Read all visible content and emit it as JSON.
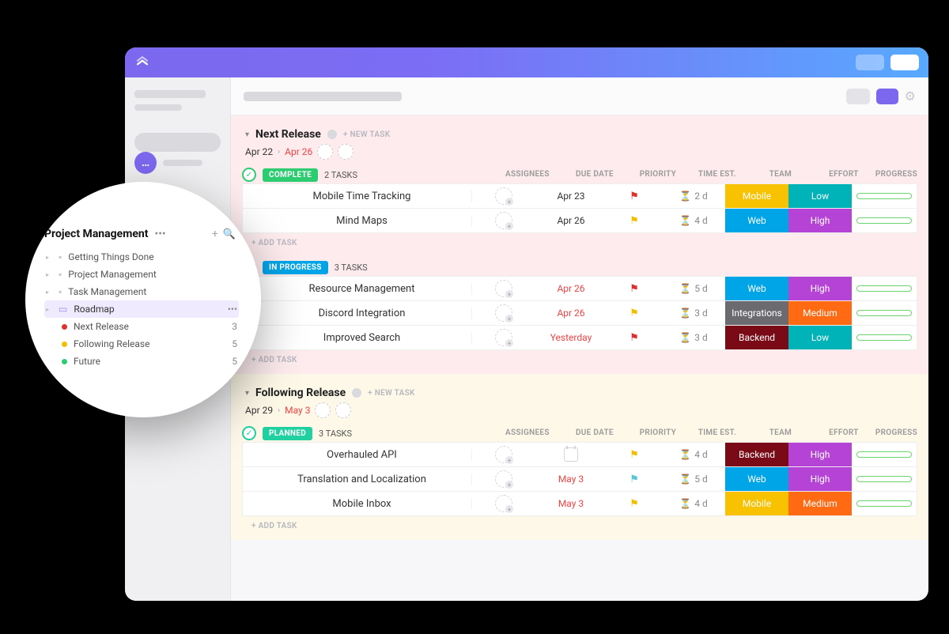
{
  "sidebar": {
    "title": "Project Management",
    "items": [
      {
        "label": "Getting Things Done"
      },
      {
        "label": "Project Management"
      },
      {
        "label": "Task Management"
      },
      {
        "label": "Roadmap",
        "selected": true
      }
    ],
    "sublists": [
      {
        "label": "Next Release",
        "count": "3",
        "dot": "red"
      },
      {
        "label": "Following Release",
        "count": "5",
        "dot": "yellow"
      },
      {
        "label": "Future",
        "count": "5",
        "dot": "green"
      }
    ]
  },
  "groups": [
    {
      "title": "Next Release",
      "new_task": "+ NEW TASK",
      "date_from": "Apr 22",
      "date_to": "Apr 26",
      "tint": "pink",
      "sections": [
        {
          "status": "COMPLETE",
          "status_color": "#2ecc71",
          "task_count": "2 TASKS",
          "tasks": [
            {
              "name": "Mobile Time Tracking",
              "due": "Apr 23",
              "due_warn": false,
              "flag": "red",
              "est": "2 d",
              "team": "Mobile",
              "team_bg": "mobile-bg",
              "effort": "Low",
              "effort_bg": "low-bg"
            },
            {
              "name": "Mind Maps",
              "due": "Apr 26",
              "due_warn": false,
              "flag": "yellow",
              "est": "4 d",
              "team": "Web",
              "team_bg": "web-bg",
              "effort": "High",
              "effort_bg": "high-bg"
            }
          ],
          "add_task": "+ ADD TASK"
        },
        {
          "status": "IN PROGRESS",
          "status_color": "#00a5e8",
          "task_count": "3 TASKS",
          "tasks": [
            {
              "name": "Resource Management",
              "due": "Apr 26",
              "due_warn": true,
              "flag": "red",
              "est": "5 d",
              "team": "Web",
              "team_bg": "web-bg",
              "effort": "High",
              "effort_bg": "high-bg"
            },
            {
              "name": "Discord Integration",
              "due": "Apr 26",
              "due_warn": true,
              "flag": "yellow",
              "est": "3 d",
              "team": "Integrations",
              "team_bg": "integrations-bg",
              "effort": "Medium",
              "effort_bg": "medium-bg"
            },
            {
              "name": "Improved Search",
              "due": "Yesterday",
              "due_warn": true,
              "flag": "red",
              "est": "3 d",
              "team": "Backend",
              "team_bg": "backend-bg",
              "effort": "Low",
              "effort_bg": "low-bg"
            }
          ],
          "add_task": "+ ADD TASK"
        }
      ]
    },
    {
      "title": "Following Release",
      "new_task": "+ NEW TASK",
      "date_from": "Apr 29",
      "date_to": "May 3",
      "tint": "yellow",
      "sections": [
        {
          "status": "PLANNED",
          "status_color": "#20d0a0",
          "task_count": "3 TASKS",
          "tasks": [
            {
              "name": "Overhauled API",
              "due": "",
              "due_warn": false,
              "flag": "yellow",
              "est": "4 d",
              "team": "Backend",
              "team_bg": "backend-bg",
              "effort": "High",
              "effort_bg": "high-bg"
            },
            {
              "name": "Translation and Localization",
              "due": "May 3",
              "due_warn": true,
              "flag": "blue",
              "est": "5 d",
              "team": "Web",
              "team_bg": "web-bg",
              "effort": "High",
              "effort_bg": "high-bg"
            },
            {
              "name": "Mobile Inbox",
              "due": "May 3",
              "due_warn": true,
              "flag": "yellow",
              "est": "4 d",
              "team": "Mobile",
              "team_bg": "mobile-bg",
              "effort": "Medium",
              "effort_bg": "medium-bg"
            }
          ],
          "add_task": "+ ADD TASK"
        }
      ]
    }
  ],
  "columns": {
    "assignees": "ASSIGNEES",
    "due": "DUE DATE",
    "priority": "PRIORITY",
    "time_est": "TIME EST.",
    "team": "TEAM",
    "effort": "EFFORT",
    "progress": "PROGRESS"
  }
}
